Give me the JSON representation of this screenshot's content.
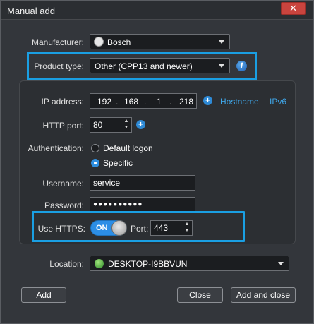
{
  "window": {
    "title": "Manual add",
    "close_glyph": "✕"
  },
  "fields": {
    "manufacturer_label": "Manufacturer:",
    "manufacturer_value": "Bosch",
    "product_type_label": "Product type:",
    "product_type_value": "Other (CPP13 and newer)",
    "ip_label": "IP address:",
    "ip_octets": [
      "192",
      "168",
      "1",
      "218"
    ],
    "ip_dot": ".",
    "hostname_link": "Hostname",
    "ipv6_link": "IPv6",
    "http_port_label": "HTTP port:",
    "http_port_value": "80",
    "auth_label": "Authentication:",
    "auth_default": "Default logon",
    "auth_specific": "Specific",
    "auth_selected": "Specific",
    "username_label": "Username:",
    "username_value": "service",
    "password_label": "Password:",
    "password_value": "●●●●●●●●●●",
    "https_label": "Use HTTPS:",
    "https_toggle": "ON",
    "port_label": "Port:",
    "port_value": "443",
    "location_label": "Location:",
    "location_value": "DESKTOP-I9BBVUN"
  },
  "buttons": {
    "add": "Add",
    "close": "Close",
    "add_and_close": "Add and close"
  },
  "icons": {
    "info": "i",
    "plus": "+",
    "spin_up": "▲",
    "spin_down": "▼"
  },
  "colors": {
    "accent": "#1a9fe3",
    "link": "#3fa6e8",
    "close_button": "#c9443e",
    "background": "#33363b"
  }
}
